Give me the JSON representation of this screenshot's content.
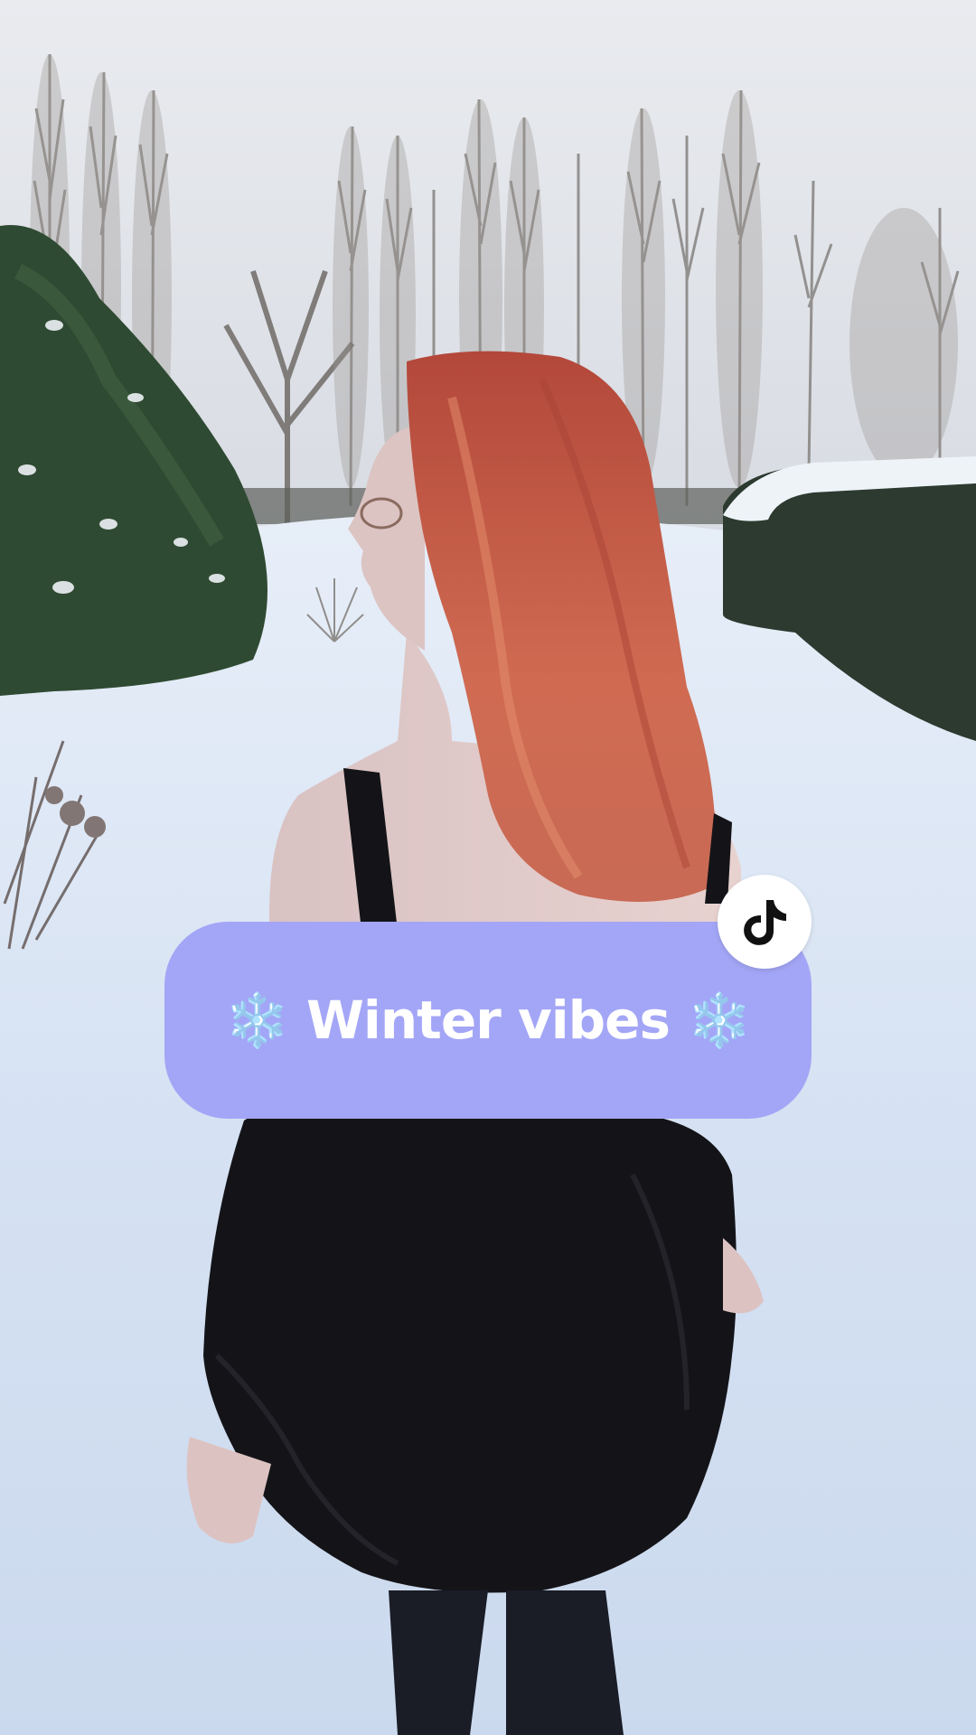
{
  "overlay": {
    "caption": "❄️ Winter vibes ❄️",
    "caption_background": "#a3a6f6",
    "caption_color": "#ffffff"
  },
  "badge": {
    "icon": "tiktok-logo-icon",
    "background": "#ffffff",
    "icon_color": "#111111"
  }
}
